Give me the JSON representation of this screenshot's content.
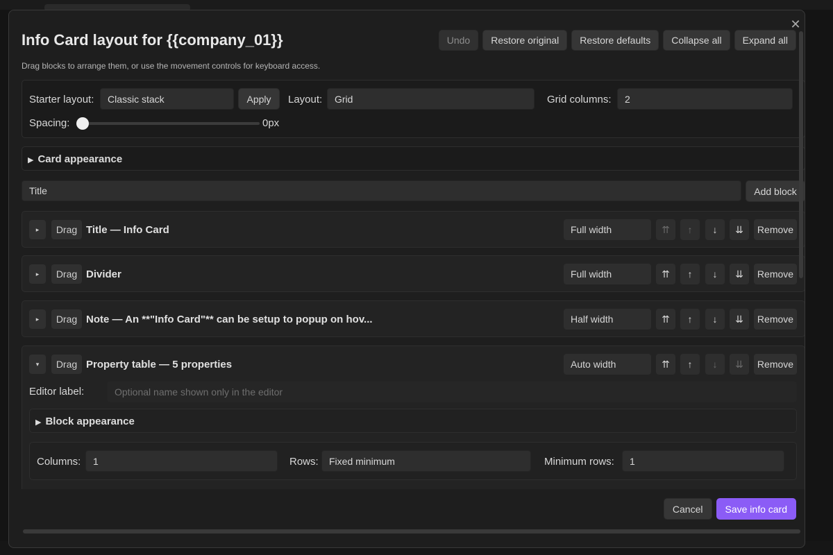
{
  "modal": {
    "title": "Info Card layout for {{company_01}}",
    "description": "Drag blocks to arrange them, or use the movement controls for keyboard access.",
    "close_glyph": "✕",
    "header_buttons": {
      "undo": "Undo",
      "restore_original": "Restore original",
      "restore_defaults": "Restore defaults",
      "collapse_all": "Collapse all",
      "expand_all": "Expand all"
    }
  },
  "layout_settings": {
    "starter_label": "Starter layout:",
    "starter_value": "Classic stack",
    "apply_label": "Apply",
    "layout_label": "Layout:",
    "layout_value": "Grid",
    "grid_columns_label": "Grid columns:",
    "grid_columns_value": "2",
    "spacing_label": "Spacing:",
    "spacing_value": "0px",
    "spacing_fraction": 0
  },
  "card_appearance": {
    "label": "Card appearance"
  },
  "add_block": {
    "value": "Title",
    "button": "Add block"
  },
  "blocks": [
    {
      "toggle": "▸",
      "drag": "Drag",
      "title": "Title — Info Card",
      "width": "Full width",
      "remove": "Remove"
    },
    {
      "toggle": "▸",
      "drag": "Drag",
      "title": "Divider",
      "width": "Full width",
      "remove": "Remove"
    },
    {
      "toggle": "▸",
      "drag": "Drag",
      "title": "Note — An **\"Info Card\"** can be setup to popup on hov...",
      "width": "Half width",
      "remove": "Remove"
    },
    {
      "toggle": "▾",
      "drag": "Drag",
      "title": "Property table — 5 properties",
      "width": "Auto width",
      "remove": "Remove"
    }
  ],
  "move_glyphs": {
    "top": "⇈",
    "up": "↑",
    "down": "↓",
    "bottom": "⇊"
  },
  "expanded_block": {
    "editor_label": "Editor label:",
    "editor_placeholder": "Optional name shown only in the editor",
    "block_appearance": "Block appearance",
    "columns_label": "Columns:",
    "columns_value": "1",
    "rows_label": "Rows:",
    "rows_value": "Fixed minimum",
    "min_rows_label": "Minimum rows:",
    "min_rows_value": "1"
  },
  "footer": {
    "cancel": "Cancel",
    "save": "Save info card"
  },
  "colors": {
    "accent": "#8b5cf6",
    "background": "#1e1e1e"
  }
}
